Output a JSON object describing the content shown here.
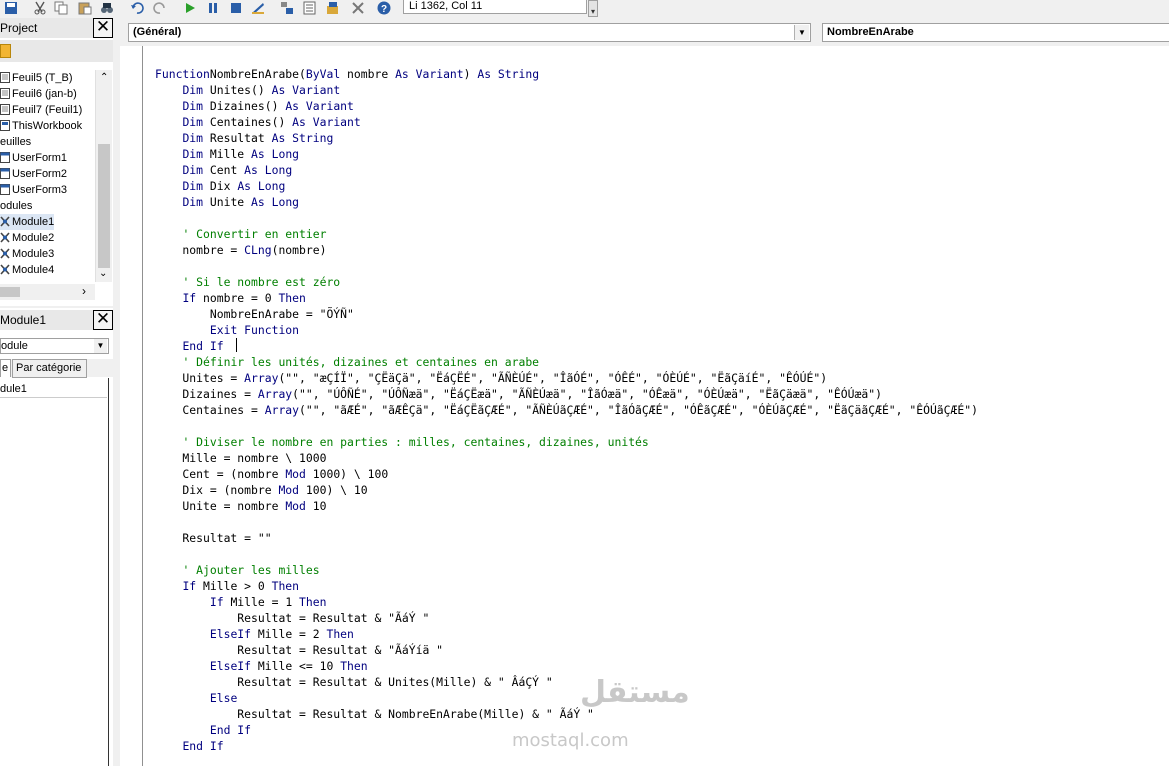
{
  "toolbar": {
    "status": "Li 1362, Col 11",
    "icons": [
      "save-icon",
      "cut-icon",
      "copy-icon",
      "paste-icon",
      "find-icon",
      "undo-icon",
      "redo-icon",
      "run-icon",
      "break-icon",
      "reset-icon",
      "design-mode-icon",
      "project-explorer-icon",
      "properties-icon",
      "object-browser-icon",
      "toolbox-icon",
      "help-icon"
    ]
  },
  "project_pane": {
    "title": "Project",
    "items": [
      {
        "label": "Feuil5 (T_B)",
        "icon": "sheet-icon"
      },
      {
        "label": "Feuil6 (jan-b)",
        "icon": "sheet-icon"
      },
      {
        "label": "Feuil7 (Feuil1)",
        "icon": "sheet-icon"
      },
      {
        "label": "ThisWorkbook",
        "icon": "workbook-icon"
      },
      {
        "label": "euilles",
        "icon": ""
      },
      {
        "label": "UserForm1",
        "icon": "form-icon"
      },
      {
        "label": "UserForm2",
        "icon": "form-icon"
      },
      {
        "label": "UserForm3",
        "icon": "form-icon"
      },
      {
        "label": "odules",
        "icon": ""
      },
      {
        "label": "Module1",
        "icon": "module-icon",
        "selected": true
      },
      {
        "label": "Module2",
        "icon": "module-icon"
      },
      {
        "label": "Module3",
        "icon": "module-icon"
      },
      {
        "label": "Module4",
        "icon": "module-icon"
      }
    ]
  },
  "properties_pane": {
    "title": "Module1",
    "combo": "odule",
    "tabs": [
      "e",
      "Par catégorie"
    ],
    "row": "dule1"
  },
  "editor": {
    "object_combo": "(Général)",
    "proc_combo": "NombreEnArabe",
    "lines": [
      [
        [
          "kw",
          "Function"
        ],
        [
          "",
          "NombreEnArabe("
        ],
        [
          "kw",
          "ByVal"
        ],
        [
          "",
          " nombre "
        ],
        [
          "kw",
          "As Variant"
        ],
        [
          "",
          ") "
        ],
        [
          "kw",
          "As String"
        ]
      ],
      [
        [
          "",
          "    "
        ],
        [
          "kw",
          "Dim"
        ],
        [
          "",
          " Unites() "
        ],
        [
          "kw",
          "As Variant"
        ]
      ],
      [
        [
          "",
          "    "
        ],
        [
          "kw",
          "Dim"
        ],
        [
          "",
          " Dizaines() "
        ],
        [
          "kw",
          "As Variant"
        ]
      ],
      [
        [
          "",
          "    "
        ],
        [
          "kw",
          "Dim"
        ],
        [
          "",
          " Centaines() "
        ],
        [
          "kw",
          "As Variant"
        ]
      ],
      [
        [
          "",
          "    "
        ],
        [
          "kw",
          "Dim"
        ],
        [
          "",
          " Resultat "
        ],
        [
          "kw",
          "As String"
        ]
      ],
      [
        [
          "",
          "    "
        ],
        [
          "kw",
          "Dim"
        ],
        [
          "",
          " Mille "
        ],
        [
          "kw",
          "As Long"
        ]
      ],
      [
        [
          "",
          "    "
        ],
        [
          "kw",
          "Dim"
        ],
        [
          "",
          " Cent "
        ],
        [
          "kw",
          "As Long"
        ]
      ],
      [
        [
          "",
          "    "
        ],
        [
          "kw",
          "Dim"
        ],
        [
          "",
          " Dix "
        ],
        [
          "kw",
          "As Long"
        ]
      ],
      [
        [
          "",
          "    "
        ],
        [
          "kw",
          "Dim"
        ],
        [
          "",
          " Unite "
        ],
        [
          "kw",
          "As Long"
        ]
      ],
      [
        [
          "",
          ""
        ]
      ],
      [
        [
          "",
          "    "
        ],
        [
          "cm",
          "' Convertir en entier"
        ]
      ],
      [
        [
          "",
          "    nombre = "
        ],
        [
          "kw",
          "CLng"
        ],
        [
          "",
          "(nombre)"
        ]
      ],
      [
        [
          "",
          ""
        ]
      ],
      [
        [
          "",
          "    "
        ],
        [
          "cm",
          "' Si le nombre est zéro"
        ]
      ],
      [
        [
          "",
          "    "
        ],
        [
          "kw",
          "If"
        ],
        [
          "",
          " nombre = 0 "
        ],
        [
          "kw",
          "Then"
        ]
      ],
      [
        [
          "",
          "        NombreEnArabe = \"ÕÝÑ\""
        ]
      ],
      [
        [
          "",
          "        "
        ],
        [
          "kw",
          "Exit Function"
        ]
      ],
      [
        [
          "",
          "    "
        ],
        [
          "kw",
          "End If"
        ]
      ],
      [
        [
          "",
          "    "
        ],
        [
          "cm",
          "' Définir les unités, dizaines et centaines en arabe"
        ]
      ],
      [
        [
          "",
          "    Unites = "
        ],
        [
          "kw",
          "Array"
        ],
        [
          "",
          "(\"\", \"æÇÍÏ\", \"ÇËäÇä\", \"ËáÇËÉ\", \"ÃÑÈÚÉ\", \"ÎãÓÉ\", \"ÓÊÉ\", \"ÓÈÚÉ\", \"ËãÇäíÉ\", \"ÊÓÚÉ\")"
        ]
      ],
      [
        [
          "",
          "    Dizaines = "
        ],
        [
          "kw",
          "Array"
        ],
        [
          "",
          "(\"\", \"ÚÔÑÉ\", \"ÚÔÑæä\", \"ËáÇËæä\", \"ÃÑÈÚæä\", \"ÎãÓæä\", \"ÓÊæä\", \"ÓÈÚæä\", \"ËãÇäæä\", \"ÊÓÚæä\")"
        ]
      ],
      [
        [
          "",
          "    Centaines = "
        ],
        [
          "kw",
          "Array"
        ],
        [
          "",
          "(\"\", \"ãÆÉ\", \"ãÆÊÇä\", \"ËáÇËãÇÆÉ\", \"ÃÑÈÚãÇÆÉ\", \"ÎãÓãÇÆÉ\", \"ÓÊãÇÆÉ\", \"ÓÈÚãÇÆÉ\", \"ËãÇäãÇÆÉ\", \"ÊÓÚãÇÆÉ\")"
        ]
      ],
      [
        [
          "",
          ""
        ]
      ],
      [
        [
          "",
          "    "
        ],
        [
          "cm",
          "' Diviser le nombre en parties : milles, centaines, dizaines, unités"
        ]
      ],
      [
        [
          "",
          "    Mille = nombre \\ 1000"
        ]
      ],
      [
        [
          "",
          "    Cent = (nombre "
        ],
        [
          "kw",
          "Mod"
        ],
        [
          "",
          " 1000) \\ 100"
        ]
      ],
      [
        [
          "",
          "    Dix = (nombre "
        ],
        [
          "kw",
          "Mod"
        ],
        [
          "",
          " 100) \\ 10"
        ]
      ],
      [
        [
          "",
          "    Unite = nombre "
        ],
        [
          "kw",
          "Mod"
        ],
        [
          "",
          " 10"
        ]
      ],
      [
        [
          "",
          ""
        ]
      ],
      [
        [
          "",
          "    Resultat = \"\""
        ]
      ],
      [
        [
          "",
          ""
        ]
      ],
      [
        [
          "",
          "    "
        ],
        [
          "cm",
          "' Ajouter les milles"
        ]
      ],
      [
        [
          "",
          "    "
        ],
        [
          "kw",
          "If"
        ],
        [
          "",
          " Mille > 0 "
        ],
        [
          "kw",
          "Then"
        ]
      ],
      [
        [
          "",
          "        "
        ],
        [
          "kw",
          "If"
        ],
        [
          "",
          " Mille = 1 "
        ],
        [
          "kw",
          "Then"
        ]
      ],
      [
        [
          "",
          "            Resultat = Resultat & \"ÃáÝ \""
        ]
      ],
      [
        [
          "",
          "        "
        ],
        [
          "kw",
          "ElseIf"
        ],
        [
          "",
          " Mille = 2 "
        ],
        [
          "kw",
          "Then"
        ]
      ],
      [
        [
          "",
          "            Resultat = Resultat & \"ÃáÝíä \""
        ]
      ],
      [
        [
          "",
          "        "
        ],
        [
          "kw",
          "ElseIf"
        ],
        [
          "",
          " Mille <= 10 "
        ],
        [
          "kw",
          "Then"
        ]
      ],
      [
        [
          "",
          "            Resultat = Resultat & Unites(Mille) & \" ÂáÇÝ \""
        ]
      ],
      [
        [
          "",
          "        "
        ],
        [
          "kw",
          "Else"
        ]
      ],
      [
        [
          "",
          "            Resultat = Resultat & NombreEnArabe(Mille) & \" ÃáÝ \""
        ]
      ],
      [
        [
          "",
          "        "
        ],
        [
          "kw",
          "End If"
        ]
      ],
      [
        [
          "",
          "    "
        ],
        [
          "kw",
          "End If"
        ]
      ]
    ]
  },
  "watermark": {
    "arabic": "مستقل",
    "latin": "mostaql.com"
  }
}
